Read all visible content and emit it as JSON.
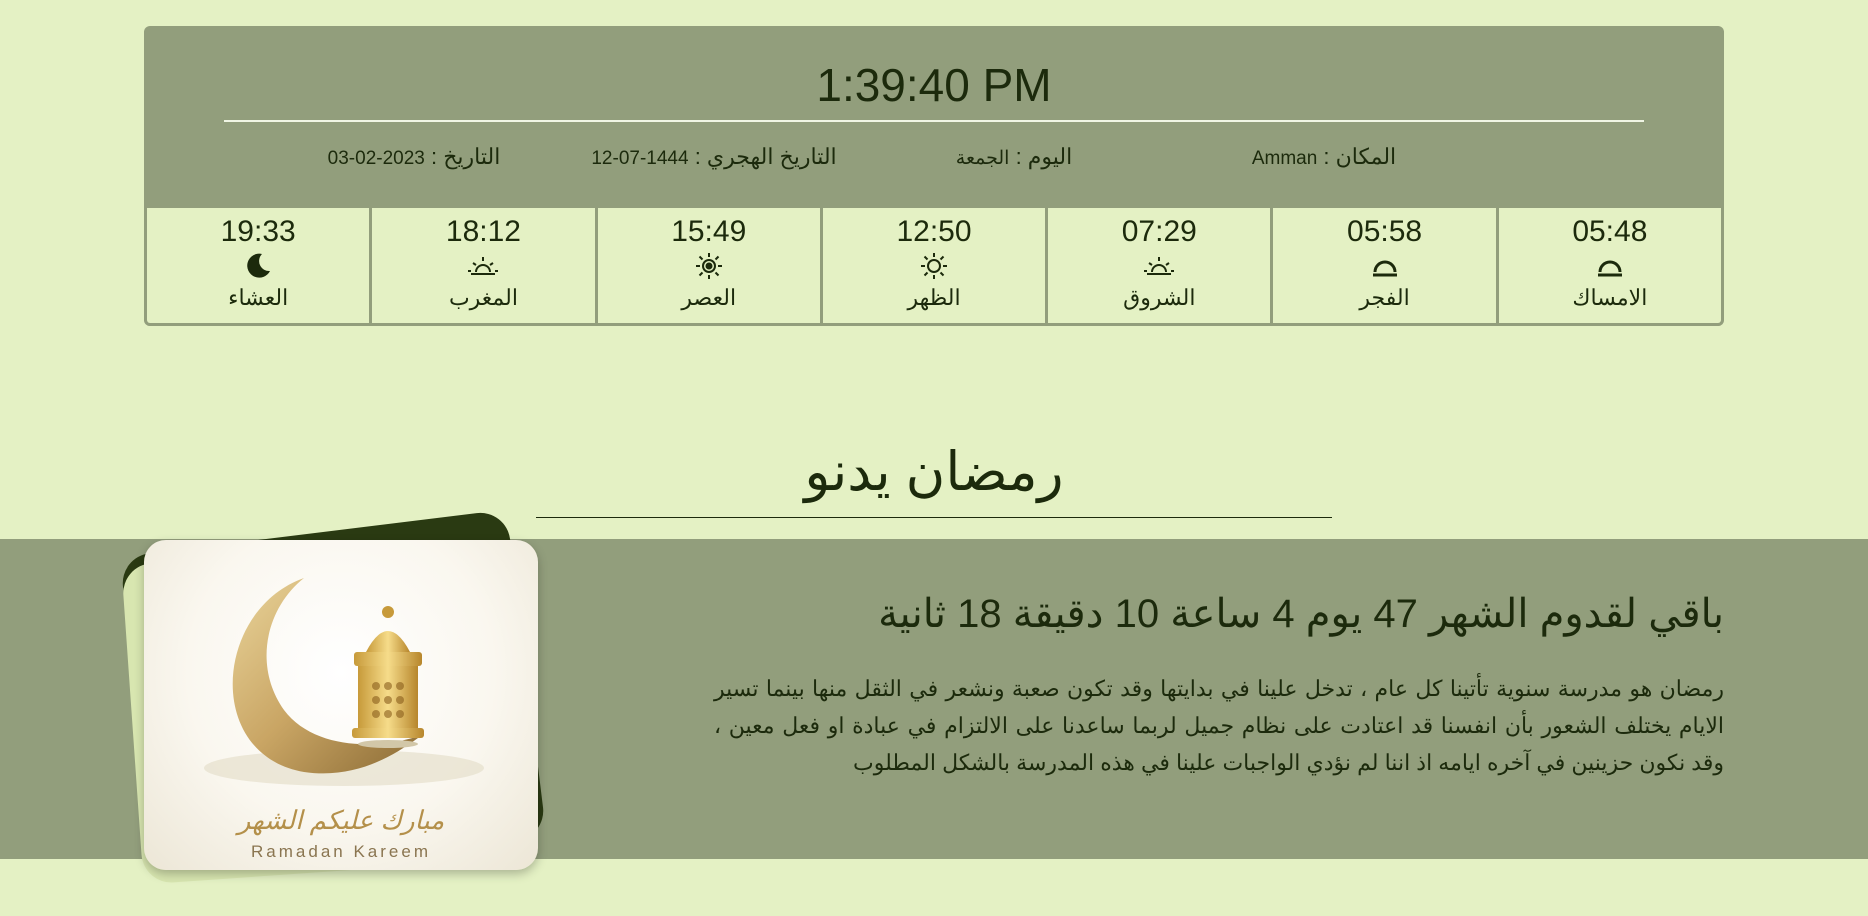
{
  "header": {
    "clock": "1:39:40 PM",
    "location_label": "المكان :",
    "location_value": "Amman",
    "day_label": "اليوم :",
    "day_value": "الجمعة",
    "hijri_label": "التاريخ الهجري :",
    "hijri_value": "1444-07-12",
    "date_label": "التاريخ :",
    "date_value": "2023-02-03"
  },
  "prayer_times": [
    {
      "time": "05:48",
      "name": "الامساك",
      "icon": "horizon-arc-icon"
    },
    {
      "time": "05:58",
      "name": "الفجر",
      "icon": "horizon-arc-icon"
    },
    {
      "time": "07:29",
      "name": "الشروق",
      "icon": "sunrise-icon"
    },
    {
      "time": "12:50",
      "name": "الظهر",
      "icon": "sun-icon"
    },
    {
      "time": "15:49",
      "name": "العصر",
      "icon": "sun-filled-icon"
    },
    {
      "time": "18:12",
      "name": "المغرب",
      "icon": "sunset-icon"
    },
    {
      "time": "19:33",
      "name": "العشاء",
      "icon": "moon-icon"
    }
  ],
  "ramadan": {
    "title": "رمضان يدنو",
    "countdown": "باقي لقدوم الشهر 47 يوم 4 ساعة 10 دقيقة 18 ثانية",
    "paragraph": "رمضان هو مدرسة سنوية تأتينا كل عام ، تدخل علينا في بدايتها وقد تكون صعبة ونشعر في الثقل منها بينما تسير الايام يختلف الشعور بأن انفسنا قد اعتادت على نظام جميل لربما ساعدنا على الالتزام في عبادة او فعل معين ، وقد نكون حزينين في آخره ايامه اذ اننا لم نؤدي الواجبات علينا في هذه المدرسة بالشكل المطلوب",
    "image_caption": "Ramadan Kareem",
    "image_arabic": "مبارك عليكم الشهر"
  },
  "colors": {
    "page_bg": "#e4f1c4",
    "panel_bg": "#929e7c",
    "text": "#1c2a0c"
  }
}
